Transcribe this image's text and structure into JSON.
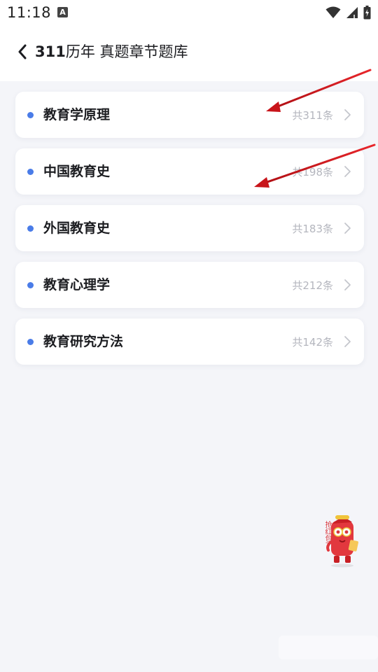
{
  "status_bar": {
    "time": "11:18",
    "notification_icon": "a-icon",
    "icons": [
      "wifi-icon",
      "signal-icon",
      "battery-icon"
    ]
  },
  "header": {
    "title_number": "311",
    "title_text": "历年 真题章节题库",
    "back_icon": "chevron-left-icon"
  },
  "chapters": [
    {
      "label": "教育学原理",
      "count": "共311条"
    },
    {
      "label": "中国教育史",
      "count": "共198条"
    },
    {
      "label": "外国教育史",
      "count": "共183条"
    },
    {
      "label": "教育心理学",
      "count": "共212条"
    },
    {
      "label": "教育研究方法",
      "count": "共142条"
    }
  ],
  "mascot": {
    "icon": "red-envelope-mascot-icon",
    "text": "抢红包了"
  },
  "colors": {
    "accent_dot": "#4a7ce8",
    "background": "#f4f5f9",
    "annotation_arrow": "#d0161b"
  }
}
